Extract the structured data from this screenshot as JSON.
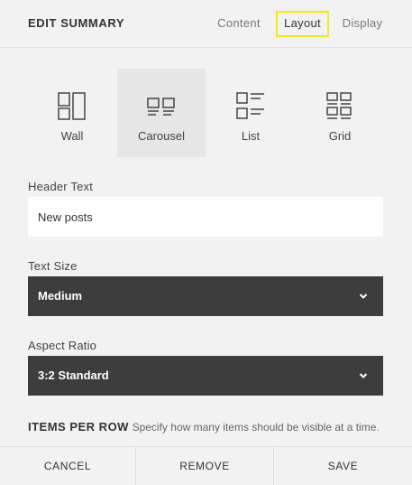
{
  "header": {
    "title": "EDIT SUMMARY",
    "tabs": {
      "content": "Content",
      "layout": "Layout",
      "display": "Display"
    },
    "active_tab": "Layout",
    "highlight_color": "#f4e81e"
  },
  "layout_options": [
    {
      "label": "Wall",
      "icon": "wall-layout-icon",
      "selected": false
    },
    {
      "label": "Carousel",
      "icon": "carousel-layout-icon",
      "selected": true
    },
    {
      "label": "List",
      "icon": "list-layout-icon",
      "selected": false
    },
    {
      "label": "Grid",
      "icon": "grid-layout-icon",
      "selected": false
    }
  ],
  "header_text": {
    "label": "Header Text",
    "value": "New posts"
  },
  "text_size": {
    "label": "Text Size",
    "value": "Medium"
  },
  "aspect_ratio": {
    "label": "Aspect Ratio",
    "value": "3:2 Standard"
  },
  "items_per_row": {
    "title": "ITEMS PER ROW",
    "description": "Specify how many items should be visible at a time."
  },
  "footer": {
    "cancel": "CANCEL",
    "remove": "REMOVE",
    "save": "SAVE"
  },
  "colors": {
    "select_background": "#3d3d3d",
    "selected_option_background": "#e6e6e6"
  }
}
